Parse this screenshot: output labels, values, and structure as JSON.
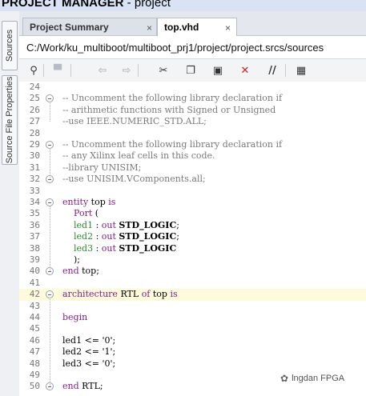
{
  "title": {
    "bold": "PROJECT MANAGER",
    "rest": " - project"
  },
  "side_tabs": [
    "Sources",
    "Source File Properties"
  ],
  "tabs": [
    {
      "label": "Project Summary",
      "close": "×"
    },
    {
      "label": "top.vhd",
      "close": "×"
    }
  ],
  "path": "C:/Work/ku_multiboot/multiboot_prj1/project/project.srcs/sources",
  "toolbar": [
    {
      "name": "search-icon",
      "glyph": "⚲",
      "color": "#333"
    },
    {
      "name": "save-icon",
      "glyph": "▀",
      "color": "#b7bcc4"
    },
    {
      "name": "undo-icon",
      "glyph": "⇦",
      "color": "#b7bcc4"
    },
    {
      "name": "redo-icon",
      "glyph": "⇨",
      "color": "#b7bcc4"
    },
    {
      "name": "cut-icon",
      "glyph": "✂",
      "color": "#333"
    },
    {
      "name": "copy-icon",
      "glyph": "❐",
      "color": "#333"
    },
    {
      "name": "paste-icon",
      "glyph": "▣",
      "color": "#333"
    },
    {
      "name": "delete-icon",
      "glyph": "✕",
      "color": "#d42020"
    },
    {
      "name": "comment-icon",
      "glyph": "//",
      "color": "#333"
    },
    {
      "name": "columns-icon",
      "glyph": "▦",
      "color": "#333"
    }
  ],
  "code_lines": [
    {
      "n": "24",
      "tokens": []
    },
    {
      "n": "25",
      "fold": true,
      "tokens": [
        [
          "c",
          "-- Uncomment the following library declaration if"
        ]
      ]
    },
    {
      "n": "26",
      "tokens": [
        [
          "c",
          "-- arithmetic functions with Signed or Unsigned"
        ]
      ]
    },
    {
      "n": "27",
      "tokens": [
        [
          "c",
          "--use IEEE.NUMERIC_STD.ALL;"
        ]
      ]
    },
    {
      "n": "28",
      "tokens": []
    },
    {
      "n": "29",
      "fold": true,
      "tokens": [
        [
          "c",
          "-- Uncomment the following library declaration if"
        ]
      ]
    },
    {
      "n": "30",
      "tokens": [
        [
          "c",
          "-- any Xilinx leaf cells in this code."
        ]
      ]
    },
    {
      "n": "31",
      "tokens": [
        [
          "c",
          "--library UNISIM;"
        ]
      ]
    },
    {
      "n": "32",
      "fold": true,
      "tokens": [
        [
          "c",
          "--use UNISIM.VComponents.all;"
        ]
      ]
    },
    {
      "n": "33",
      "tokens": []
    },
    {
      "n": "34",
      "fold": true,
      "tokens": [
        [
          "k",
          "entity"
        ],
        [
          "p",
          " top "
        ],
        [
          "k",
          "is"
        ]
      ]
    },
    {
      "n": "35",
      "tokens": [
        [
          "p",
          "    "
        ],
        [
          "k",
          "Port"
        ],
        [
          "p",
          " ("
        ]
      ]
    },
    {
      "n": "36",
      "tokens": [
        [
          "p",
          "    "
        ],
        [
          "s",
          "led1"
        ],
        [
          "p",
          " : "
        ],
        [
          "k",
          "out"
        ],
        [
          "p",
          " "
        ],
        [
          "ty",
          "STD_LOGIC"
        ],
        [
          "p",
          ";"
        ]
      ]
    },
    {
      "n": "37",
      "tokens": [
        [
          "p",
          "    "
        ],
        [
          "s",
          "led2"
        ],
        [
          "p",
          " : "
        ],
        [
          "k",
          "out"
        ],
        [
          "p",
          " "
        ],
        [
          "ty",
          "STD_LOGIC"
        ],
        [
          "p",
          ";"
        ]
      ]
    },
    {
      "n": "38",
      "tokens": [
        [
          "p",
          "    "
        ],
        [
          "s",
          "led3"
        ],
        [
          "p",
          " : "
        ],
        [
          "k",
          "out"
        ],
        [
          "p",
          " "
        ],
        [
          "ty",
          "STD_LOGIC"
        ]
      ]
    },
    {
      "n": "39",
      "tokens": [
        [
          "p",
          "    );"
        ]
      ]
    },
    {
      "n": "40",
      "fold": true,
      "tokens": [
        [
          "k",
          "end"
        ],
        [
          "p",
          " top;"
        ]
      ]
    },
    {
      "n": "41",
      "tokens": []
    },
    {
      "n": "42",
      "fold": true,
      "hl": true,
      "tokens": [
        [
          "k",
          "architecture"
        ],
        [
          "p",
          " RTL "
        ],
        [
          "k",
          "of"
        ],
        [
          "p",
          " top "
        ],
        [
          "k",
          "is"
        ]
      ]
    },
    {
      "n": "43",
      "tokens": []
    },
    {
      "n": "44",
      "tokens": [
        [
          "k",
          "begin"
        ]
      ]
    },
    {
      "n": "45",
      "tokens": []
    },
    {
      "n": "46",
      "tokens": [
        [
          "p",
          "led1 <= '0';"
        ]
      ]
    },
    {
      "n": "47",
      "tokens": [
        [
          "p",
          "led2 <= '1';"
        ]
      ]
    },
    {
      "n": "48",
      "tokens": [
        [
          "p",
          "led3 <= '0';"
        ]
      ]
    },
    {
      "n": "49",
      "tokens": []
    },
    {
      "n": "50",
      "fold": true,
      "tokens": [
        [
          "k",
          "end"
        ],
        [
          "p",
          " RTL;"
        ]
      ]
    }
  ],
  "watermark": "lngdan FPGA"
}
